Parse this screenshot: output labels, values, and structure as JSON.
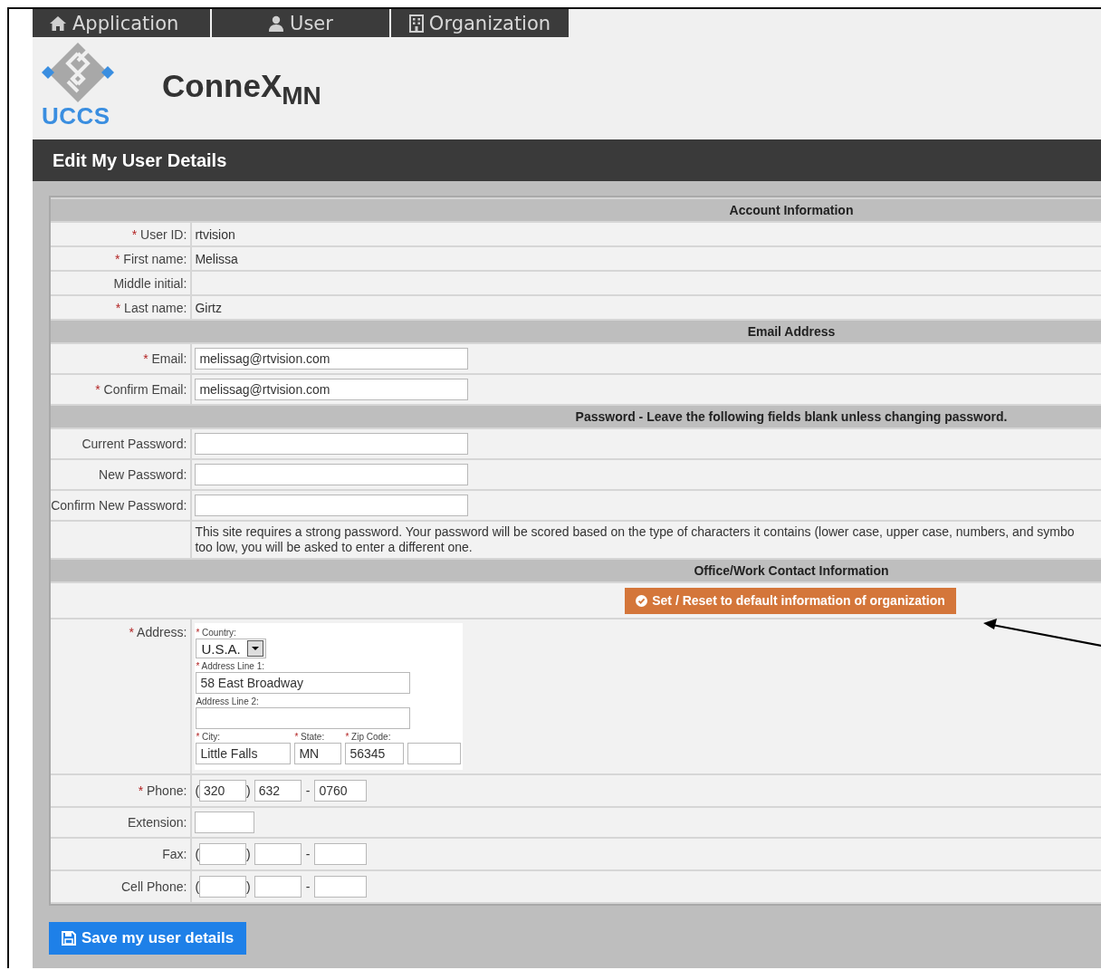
{
  "tabs": [
    {
      "label": "Application"
    },
    {
      "label": "User"
    },
    {
      "label": "Organization"
    }
  ],
  "logo": {
    "text": "UCCS"
  },
  "site_title": "ConneX$_{MN}$",
  "page_title": "Edit My User Details",
  "sections": [
    {
      "heading": "Account Information",
      "rows": [
        {
          "kind": "text",
          "mark": "*",
          "label": "User ID:",
          "value": "rtvision"
        },
        {
          "kind": "text",
          "mark": "*",
          "label": "First name:",
          "value": "Melissa"
        },
        {
          "kind": "text",
          "label": "Middle initial:"
        },
        {
          "kind": "text",
          "mark": "*",
          "label": "Last name:",
          "value": "Girtz"
        }
      ]
    },
    {
      "heading": "Email Address",
      "rows": [
        {
          "kind": "input",
          "mark": "*",
          "label": "Email:",
          "value": "melissag@rtvision.com"
        },
        {
          "kind": "input",
          "mark": "*",
          "label": "Confirm Email:",
          "value": "melissag@rtvision.com"
        }
      ]
    },
    {
      "heading": "Password - Leave the following fields blank unless changing password.",
      "rows": [
        {
          "kind": "input",
          "label": "Current Password:"
        },
        {
          "kind": "input_split",
          "label": "New Password:"
        },
        {
          "kind": "input_split",
          "label": "Confirm New Password:"
        },
        {
          "kind": "note",
          "lines": [
            "This site requires a strong password. Your password will be scored based on the type of characters it contains (lower case, upper case, numbers, and symbo",
            "too low, you will be asked to enter a different one."
          ]
        }
      ]
    },
    {
      "heading": "Office/Work Contact Information",
      "rows": [
        {
          "kind": "action",
          "button": "Set / Reset to default information of organization"
        },
        {
          "kind": "address",
          "mark": "*",
          "label": "Address:",
          "country": {
            "mark": "*",
            "label": "Country:",
            "value": "U.S.A."
          },
          "line1": {
            "mark": "*",
            "label": "Address Line 1:",
            "value": "58 East Broadway"
          },
          "line2": {
            "label": "Address Line 2:"
          },
          "city": {
            "mark": "*",
            "label": "City:",
            "value": "Little Falls"
          },
          "state": {
            "mark": "*",
            "label": "State:",
            "value": "MN"
          },
          "zip": {
            "mark": "*",
            "label": "Zip Code:",
            "value": "56345"
          }
        },
        {
          "kind": "phone",
          "mark": "*",
          "label": "Phone:",
          "open": "(",
          "close": ")",
          "sep": "-",
          "area": "320",
          "prefix": "632",
          "line": "0760"
        },
        {
          "kind": "short_input",
          "label": "Extension:"
        },
        {
          "kind": "phone",
          "label": "Fax:",
          "open": "(",
          "close": ")",
          "sep": "-"
        },
        {
          "kind": "phone",
          "label": "Cell Phone:",
          "open": "(",
          "close": ")",
          "sep": "-"
        }
      ]
    }
  ],
  "save_button": "Save my user details"
}
